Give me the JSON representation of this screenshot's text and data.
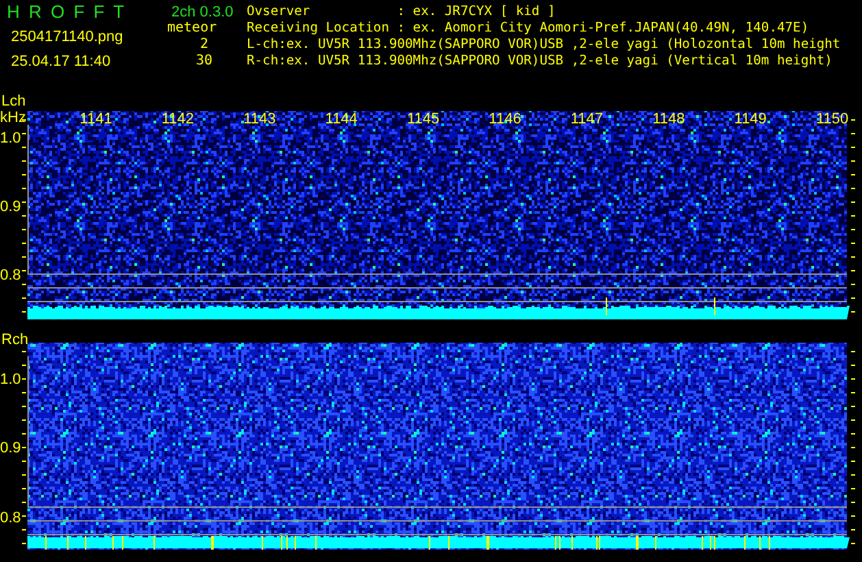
{
  "app": {
    "logo": "H R O F F T",
    "version": "2ch 0.3.0",
    "filename": "2504171140.png",
    "timestamp": "25.04.17 11:40"
  },
  "meteor": {
    "label": "meteor",
    "counts": [
      "2",
      "30"
    ]
  },
  "info_lines": [
    "Ovserver           : ex. JR7CYX [ kid ]",
    "Receiving Location : ex. Aomori City Aomori-Pref.JAPAN(40.49N, 140.47E)",
    "L-ch:ex. UV5R 113.900Mhz(SAPPORO VOR)USB ,2-ele yagi (Holozontal 10m height",
    "R-ch:ex. UV5R 113.900Mhz(SAPPORO VOR)USB ,2-ele yagi (Vertical 10m height)"
  ],
  "panels": [
    {
      "channel": "Lch",
      "unit": "kHz",
      "time_labels": [
        "1141",
        "1142",
        "1143",
        "1144",
        "1145",
        "1146",
        "1147",
        "1148",
        "1149",
        "1150"
      ],
      "y_labels": [
        "1.0",
        "0.9",
        "0.8"
      ]
    },
    {
      "channel": "Rch",
      "y_labels": [
        "1.0",
        "0.9",
        "0.8"
      ]
    }
  ]
}
